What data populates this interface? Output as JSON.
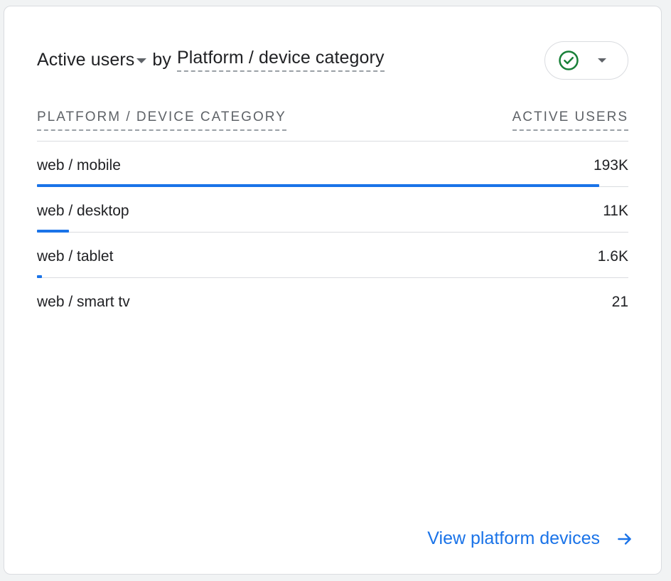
{
  "header": {
    "metric": "Active users",
    "by_word": "by",
    "dimension": "Platform / device category"
  },
  "table": {
    "columns": [
      "PLATFORM / DEVICE CATEGORY",
      "ACTIVE USERS"
    ],
    "rows": [
      {
        "label": "web / mobile",
        "value": "193K",
        "share": 0.951
      },
      {
        "label": "web / desktop",
        "value": "11K",
        "share": 0.054
      },
      {
        "label": "web / tablet",
        "value": "1.6K",
        "share": 0.008
      },
      {
        "label": "web / smart tv",
        "value": "21",
        "share": 0.0001
      }
    ]
  },
  "footer": {
    "link_label": "View platform devices"
  },
  "icons": {
    "status": "check-circle-icon",
    "status_dropdown": "caret-down-icon",
    "metric_dropdown": "caret-down-icon",
    "link_arrow": "arrow-right-icon"
  },
  "colors": {
    "accent": "#1a73e8",
    "status_ok": "#188038",
    "text": "#202124",
    "muted": "#5f6368",
    "divider": "#dadce0"
  }
}
